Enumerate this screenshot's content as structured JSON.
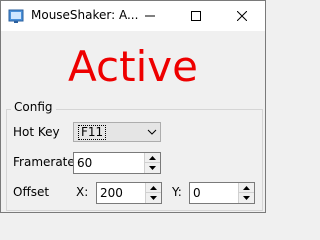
{
  "window": {
    "title": "MouseShaker: A..."
  },
  "status": {
    "text": "Active",
    "color": "#ee0000"
  },
  "config": {
    "group_label": "Config",
    "hotkey": {
      "label": "Hot Key",
      "value": "F11"
    },
    "framerate": {
      "label": "Framerate",
      "value": "60"
    },
    "offset": {
      "label": "Offset",
      "x_label": "X:",
      "x_value": "200",
      "y_label": "Y:",
      "y_value": "0"
    }
  }
}
